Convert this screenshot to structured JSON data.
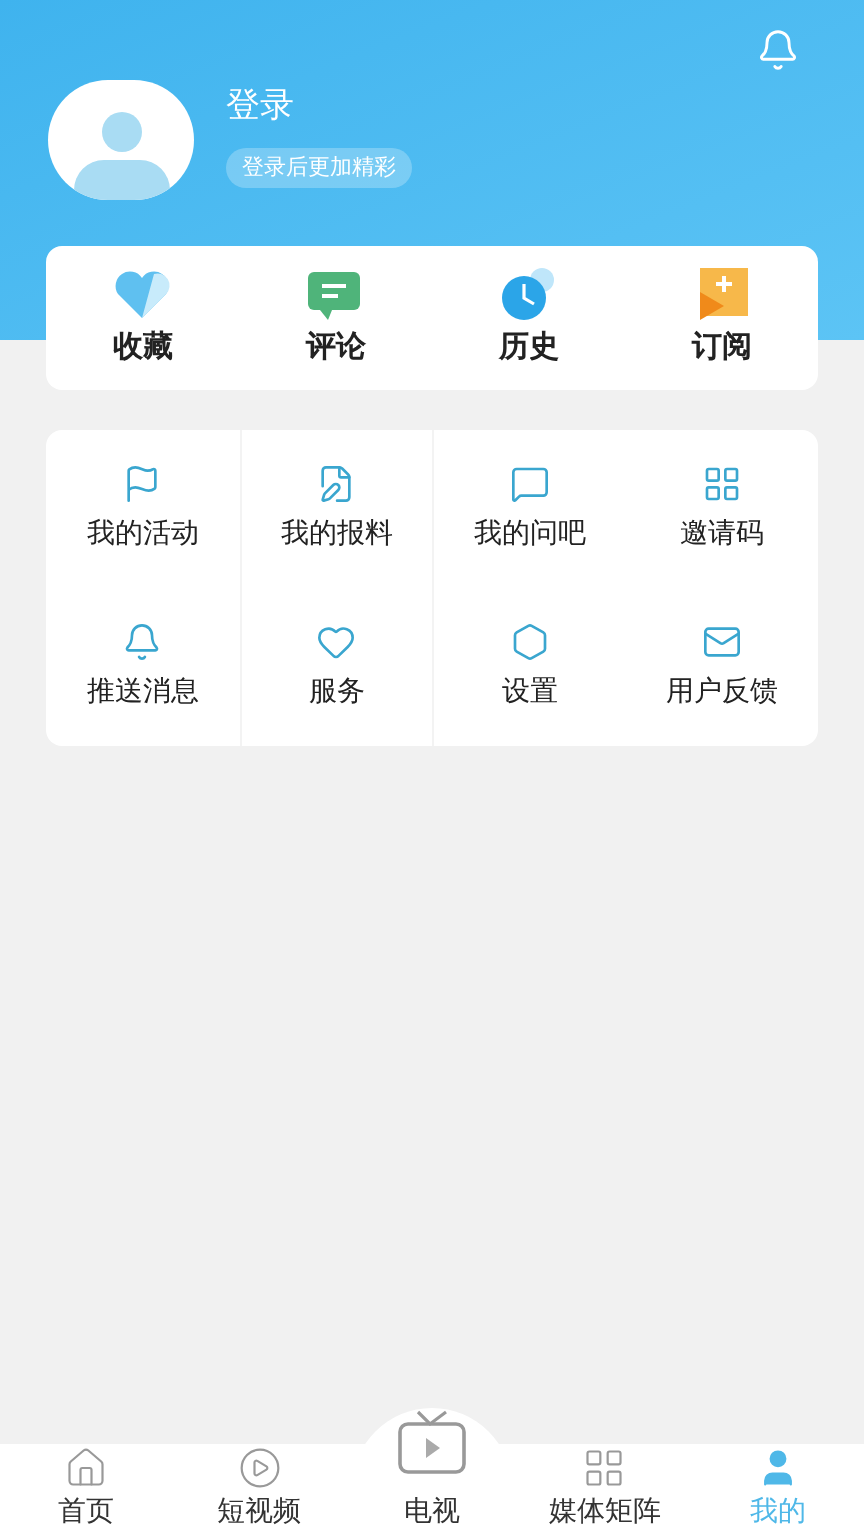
{
  "profile": {
    "name": "登录",
    "hint": "登录后更加精彩"
  },
  "shortcuts": [
    {
      "label": "收藏"
    },
    {
      "label": "评论"
    },
    {
      "label": "历史"
    },
    {
      "label": "订阅"
    }
  ],
  "menu": [
    {
      "label": "我的活动"
    },
    {
      "label": "我的报料"
    },
    {
      "label": "我的问吧"
    },
    {
      "label": "邀请码"
    },
    {
      "label": "推送消息"
    },
    {
      "label": "服务"
    },
    {
      "label": "设置"
    },
    {
      "label": "用户反馈"
    }
  ],
  "tabbar": [
    {
      "label": "首页",
      "kind": "normal",
      "selected": false
    },
    {
      "label": "短视频",
      "kind": "normal",
      "selected": false
    },
    {
      "label": "电视",
      "kind": "center",
      "selected": false
    },
    {
      "label": "媒体矩阵",
      "kind": "normal",
      "selected": false
    },
    {
      "label": "我的",
      "kind": "normal",
      "selected": true
    }
  ]
}
